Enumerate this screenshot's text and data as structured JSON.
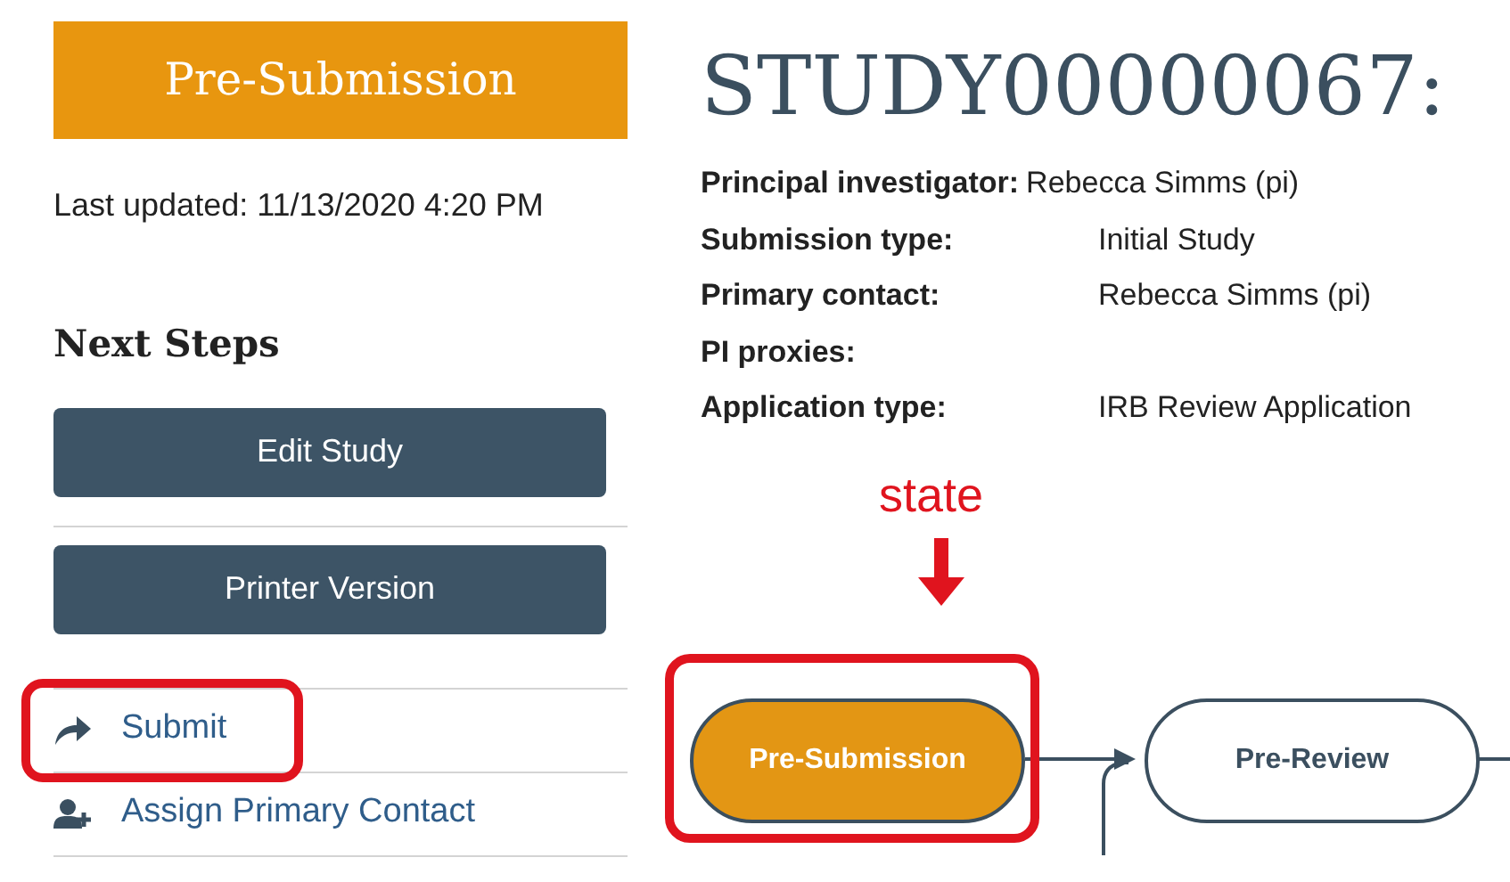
{
  "status_badge": "Pre-Submission",
  "last_updated": "Last updated: 11/13/2020 4:20 PM",
  "next_steps": {
    "heading": "Next Steps",
    "buttons": [
      "Edit Study",
      "Printer Version"
    ],
    "actions": [
      {
        "label": "Submit",
        "kind": "submit",
        "highlighted": true
      },
      {
        "label": "Assign Primary Contact",
        "kind": "assign",
        "highlighted": false
      }
    ]
  },
  "title": "STUDY00000067:",
  "details": [
    {
      "label": "Principal investigator:",
      "value": "Rebecca Simms (pi)",
      "kind": "inline"
    },
    {
      "label": "Submission type:",
      "value": "Initial Study",
      "kind": "column"
    },
    {
      "label": "Primary contact:",
      "value": "Rebecca Simms (pi)",
      "kind": "column"
    },
    {
      "label": "PI proxies:",
      "kind": "column"
    },
    {
      "label": "Application type:",
      "value": "IRB Review Application",
      "kind": "column"
    }
  ],
  "workflow": {
    "annotation": "state",
    "nodes": [
      {
        "label": "Pre-Submission",
        "current": true
      },
      {
        "label": "Pre-Review",
        "current": false
      }
    ]
  }
}
